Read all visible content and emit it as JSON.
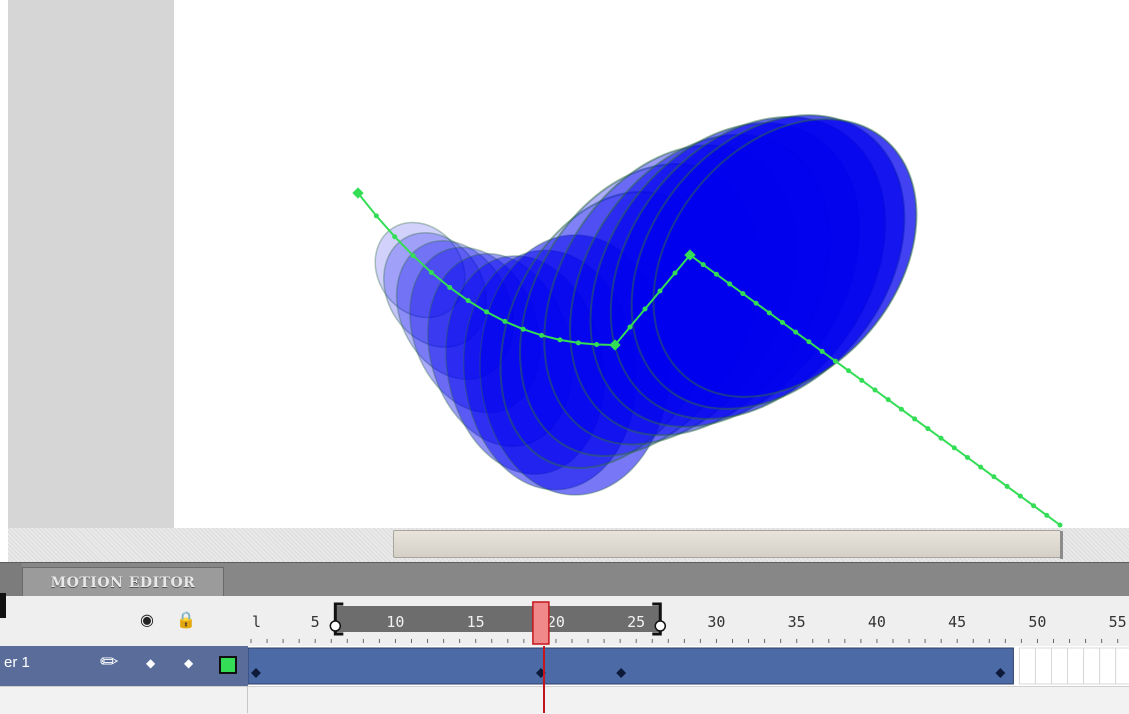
{
  "panel": {
    "tab_label": "MOTION EDITOR"
  },
  "timeline": {
    "layer_name": "er 1",
    "layer_color": "#33dd55",
    "ruler_labels": [
      "l",
      "5",
      "10",
      "15",
      "20",
      "25",
      "30",
      "35",
      "40",
      "45",
      "50",
      "55"
    ],
    "current_frame": 19,
    "span_start_frame": 7,
    "span_end_frame": 26,
    "keyframes": [
      1,
      19,
      24,
      48
    ],
    "tween_end_frame": 48
  },
  "colors": {
    "shape_fill": "#0000ee",
    "motion_path": "#33dd55",
    "tween_span": "#4c6aa6",
    "playhead": "#c4161c"
  },
  "icons": {
    "eye": "eye-icon",
    "lock": "lock-icon",
    "outline": "outline-icon",
    "pencil": "pencil-icon"
  }
}
